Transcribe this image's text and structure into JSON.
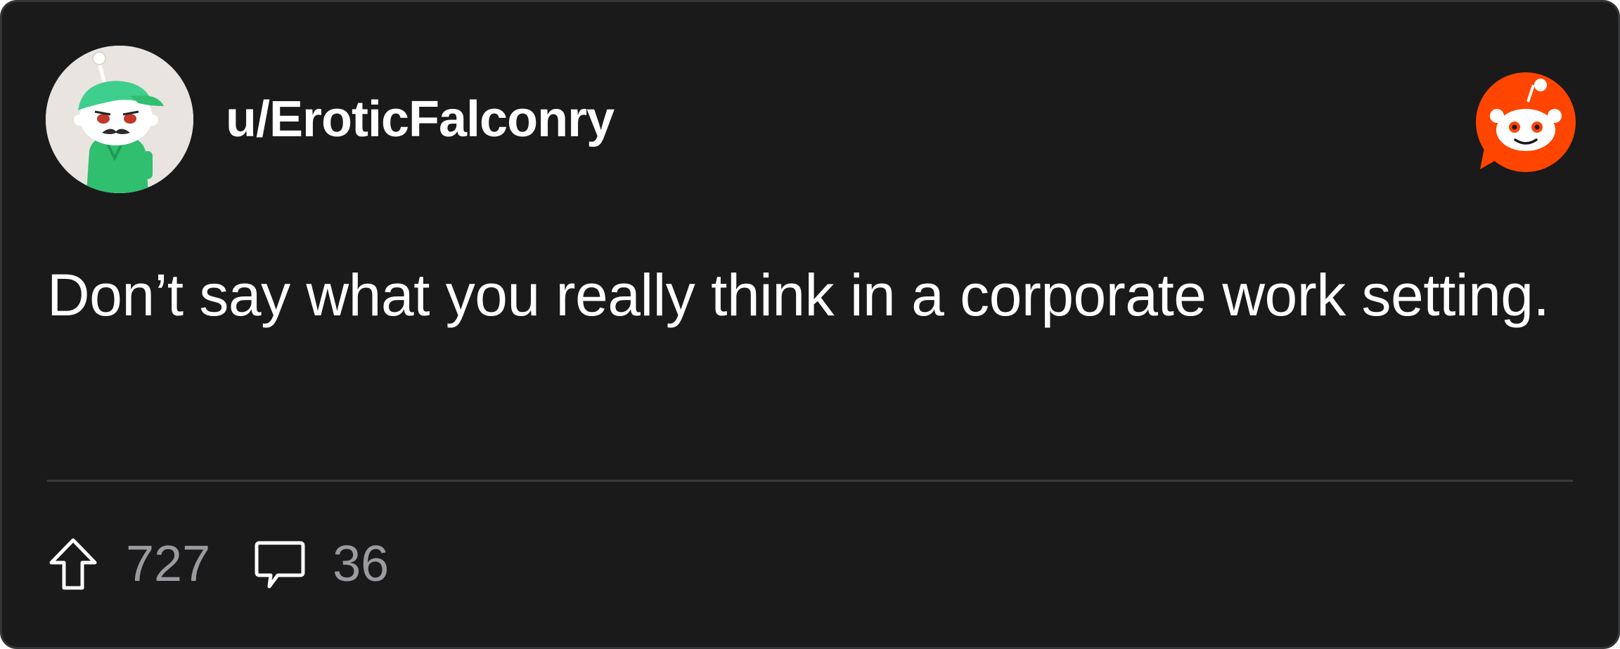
{
  "post": {
    "username": "u/EroticFalconry",
    "text": "Don’t say what you really think in a corporate work setting.",
    "upvotes": "727",
    "comments": "36"
  },
  "icons": {
    "avatar": "snoo-avatar-icon",
    "brand": "reddit-logo-icon",
    "upvote": "upvote-arrow-icon",
    "comment": "comment-bubble-icon"
  },
  "colors": {
    "card_background": "#1a1a1b",
    "text_primary": "#ffffff",
    "text_muted": "#9b9b9f",
    "reddit_orange": "#ff4500",
    "avatar_green": "#3ecf8e"
  }
}
